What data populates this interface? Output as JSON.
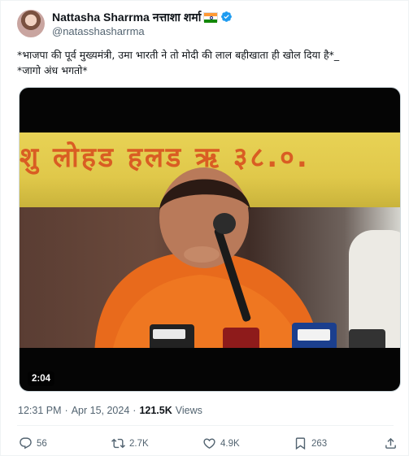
{
  "author": {
    "display_name": "Nattasha Sharrma नत्ताशा शर्मा",
    "handle": "@natasshasharrma",
    "verified": true,
    "flag_icon": "india-flag-icon"
  },
  "tweet": {
    "text_line1": "*भाजपा की पूर्व मुख्यमंत्री, उमा भारती ने तो मोदी की लाल बहीखाता ही खोल दिया है*_",
    "text_line2": "*जागो अंध भगतो*"
  },
  "media": {
    "duration": "2:04",
    "banner_text": "शु लोहड हलड ऋ   ३८.०."
  },
  "meta": {
    "time": "12:31 PM",
    "separator1": "·",
    "date": "Apr 15, 2024",
    "separator2": "·",
    "views_count": "121.5K",
    "views_label": "Views"
  },
  "actions": {
    "replies": "56",
    "reposts": "2.7K",
    "likes": "4.9K",
    "bookmarks": "263"
  },
  "colors": {
    "text_primary": "#0f1419",
    "text_secondary": "#536471",
    "verified_blue": "#1d9bf0",
    "saffron": "#ff671f",
    "india_green": "#046a38"
  }
}
